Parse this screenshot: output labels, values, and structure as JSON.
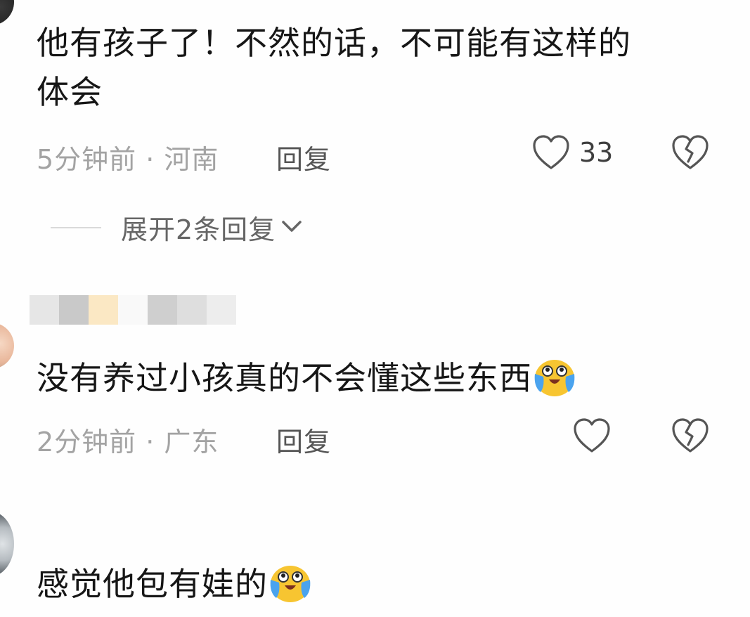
{
  "comments": [
    {
      "text_line1": "他有孩子了！不然的话，不可能有这样的",
      "text_line2": "体会",
      "meta": "5分钟前 · 河南",
      "reply": "回复",
      "likes": "33",
      "expand": "展开2条回复"
    },
    {
      "text": "没有养过小孩真的不会懂这些东西",
      "emoji": "crying-face-emoji",
      "meta": "2分钟前 · 广东",
      "reply": "回复"
    },
    {
      "text": "感觉他包有娃的",
      "emoji": "crying-face-emoji"
    }
  ],
  "icons": {
    "like": "heart-outline-icon",
    "dislike": "broken-heart-icon",
    "expand": "chevron-down-icon"
  },
  "colors": {
    "text": "#161616",
    "meta": "#a3a3a3",
    "icon": "#555555",
    "emoji_face": "#f7c531",
    "emoji_tear": "#4aa3ee"
  }
}
